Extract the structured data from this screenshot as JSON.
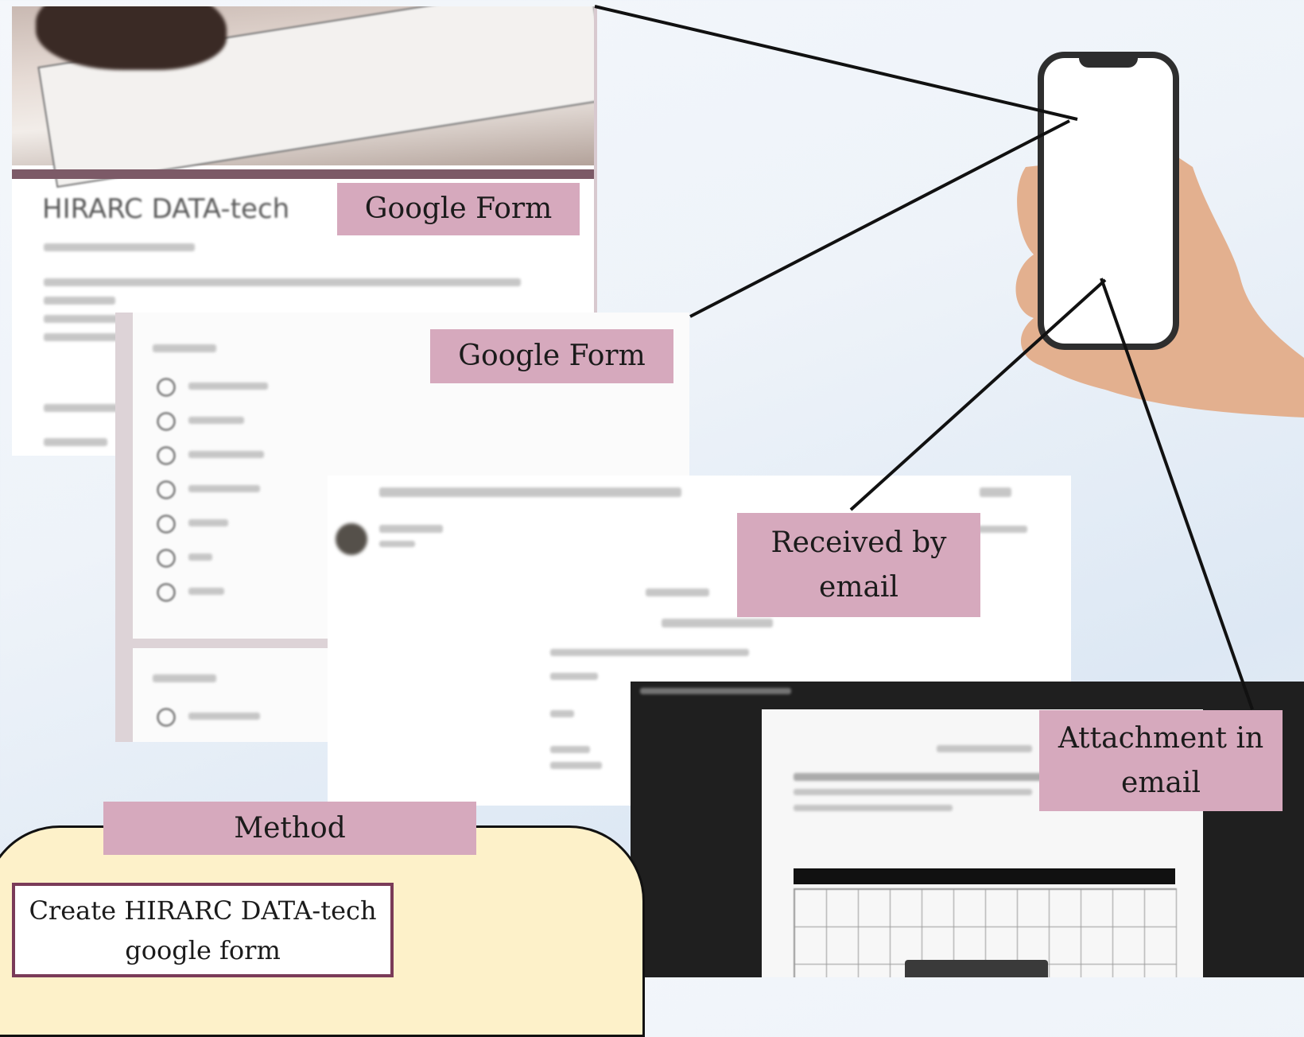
{
  "labels": {
    "google_form_1": "Google Form",
    "google_form_2": "Google Form",
    "received": "Received by email",
    "attachment": "Attachment in email",
    "method": "Method"
  },
  "form1": {
    "title": "HIRARC DATA-tech"
  },
  "method": {
    "step1": "Create HIRARC DATA-tech google form"
  },
  "colors": {
    "label_bg": "#d6a9bd",
    "method_panel": "#fdf1c9",
    "step_border": "#7a3b58",
    "connector": "#111111"
  }
}
